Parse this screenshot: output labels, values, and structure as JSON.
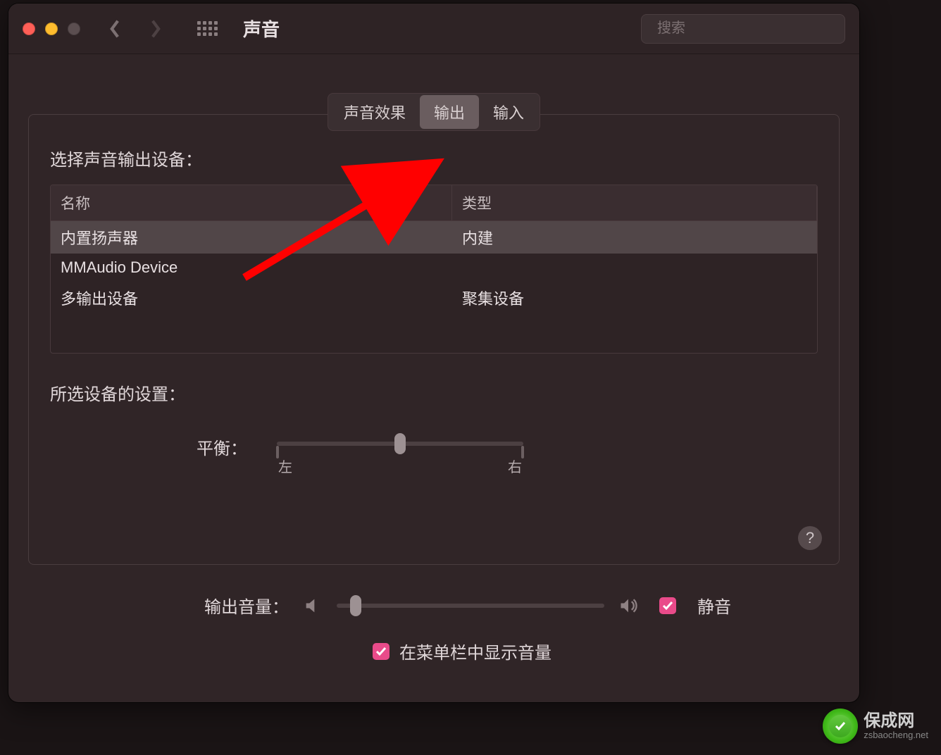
{
  "titlebar": {
    "title": "声音",
    "search_placeholder": "搜索"
  },
  "tabs": {
    "sound_effects": "声音效果",
    "output": "输出",
    "input": "输入"
  },
  "output_panel": {
    "select_device_label": "选择声音输出设备：",
    "columns": {
      "name": "名称",
      "type": "类型"
    },
    "devices": [
      {
        "name": "内置扬声器",
        "type": "内建",
        "selected": true
      },
      {
        "name": "MMAudio Device",
        "type": "",
        "selected": false
      },
      {
        "name": "多输出设备",
        "type": "聚集设备",
        "selected": false
      }
    ],
    "settings_label": "所选设备的设置：",
    "balance": {
      "label": "平衡：",
      "left": "左",
      "right": "右",
      "value": 50
    },
    "help": "?"
  },
  "footer": {
    "output_volume_label": "输出音量：",
    "mute_label": "静音",
    "mute_checked": true,
    "show_in_menubar_label": "在菜单栏中显示音量",
    "show_in_menubar_checked": true
  },
  "watermark": {
    "title": "保成网",
    "sub": "zsbaocheng.net"
  }
}
